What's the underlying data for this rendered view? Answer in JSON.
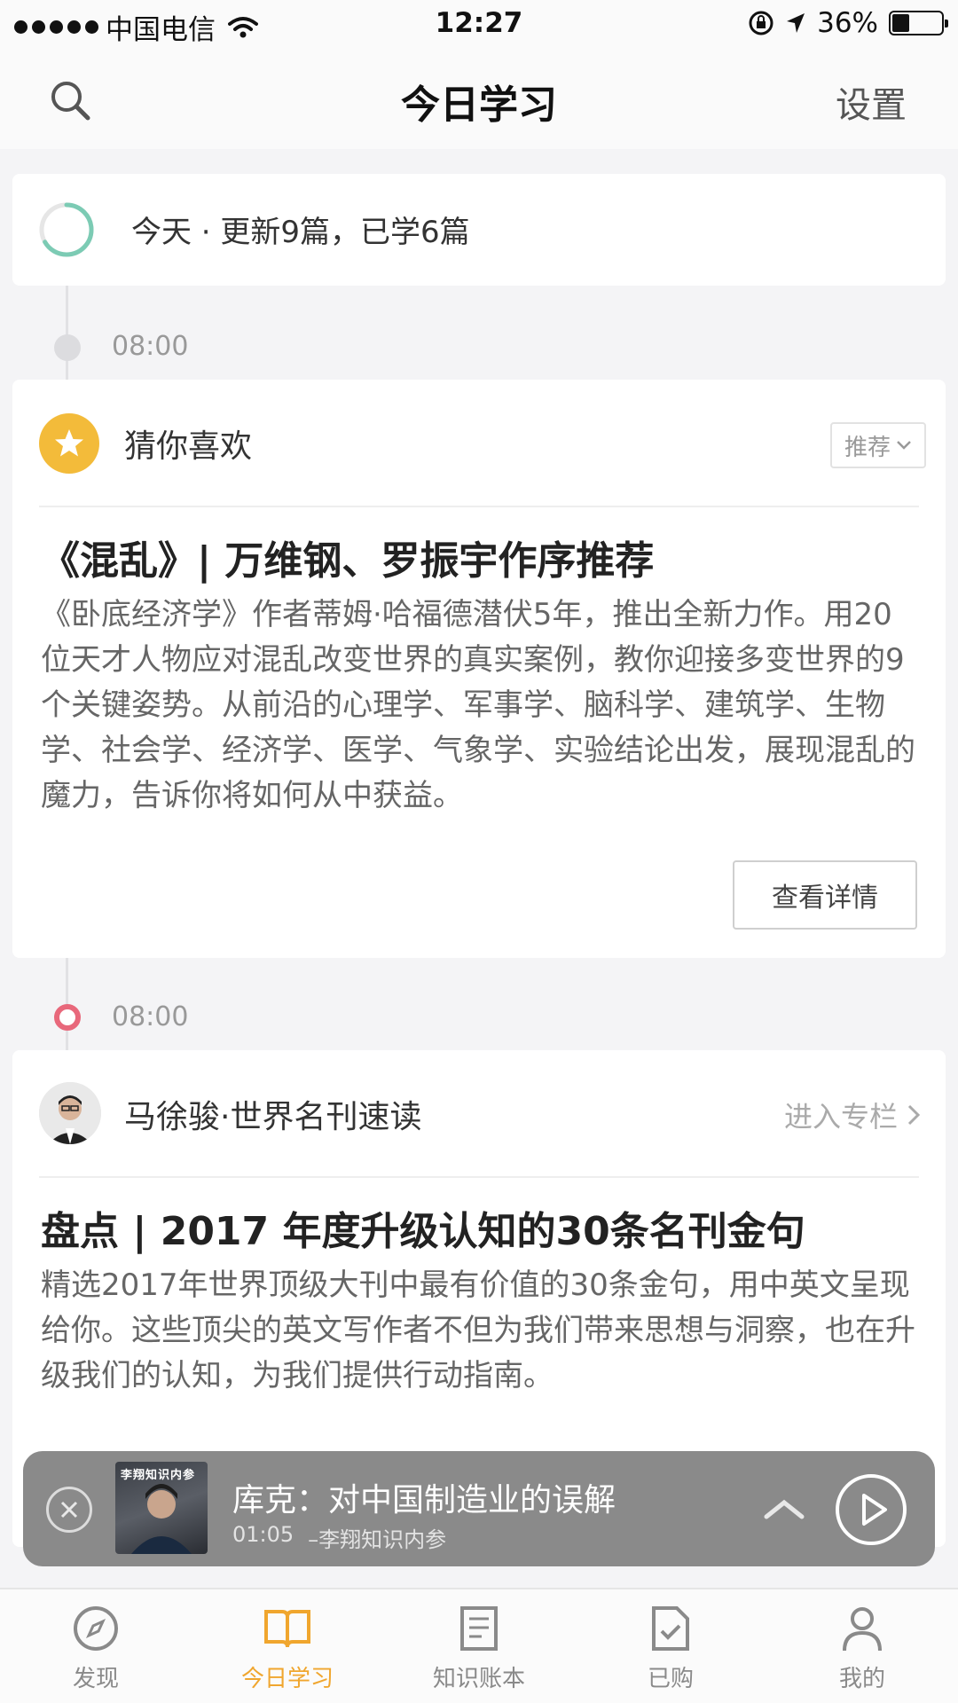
{
  "status_bar": {
    "carrier": "中国电信",
    "time": "12:27",
    "battery": "36%",
    "battery_level": 0.36
  },
  "header": {
    "title": "今日学习",
    "settings_label": "设置",
    "search_icon": "search-icon"
  },
  "summary": {
    "text": "今天 · 更新9篇，已学6篇",
    "updated": 9,
    "learned": 6
  },
  "timeline": [
    {
      "time": "08:00",
      "source": "猜你喜欢",
      "tag": "推荐",
      "title": "《混乱》| 万维钢、罗振宇作序推荐",
      "body": "《卧底经济学》作者蒂姆·哈福德潜伏5年，推出全新力作。用20位天才人物应对混乱改变世界的真实案例，教你迎接多变世界的9个关键姿势。从前沿的心理学、军事学、脑科学、建筑学、生物学、社会学、经济学、医学、气象学、实验结论出发，展现混乱的魔力，告诉你将如何从中获益。",
      "button": "查看详情"
    },
    {
      "time": "08:00",
      "source": "马徐骏·世界名刊速读",
      "link": "进入专栏",
      "title": "盘点 | 2017 年度升级认知的30条名刊金句",
      "body": "精选2017年世界顶级大刊中最有价值的30条金句，用中英文呈现给你。这些顶尖的英文写作者不但为我们带来思想与洞察，也在升级我们的认知，为我们提供行动指南。"
    }
  ],
  "player": {
    "cover_text": "李翔知识内参",
    "title": "库克：对中国制造业的误解",
    "elapsed": "01:05",
    "author": "–李翔知识内参"
  },
  "tabs": [
    {
      "label": "发现",
      "icon": "compass-icon"
    },
    {
      "label": "今日学习",
      "icon": "book-icon"
    },
    {
      "label": "知识账本",
      "icon": "notebook-icon"
    },
    {
      "label": "已购",
      "icon": "purchased-icon"
    },
    {
      "label": "我的",
      "icon": "profile-icon"
    }
  ],
  "colors": {
    "accent": "#f0a62e",
    "ring": "#7ccbb4",
    "timeline_dot_active": "#e8687b",
    "badge": "#f3bb3a",
    "player_bg": "#8a8a8a"
  }
}
